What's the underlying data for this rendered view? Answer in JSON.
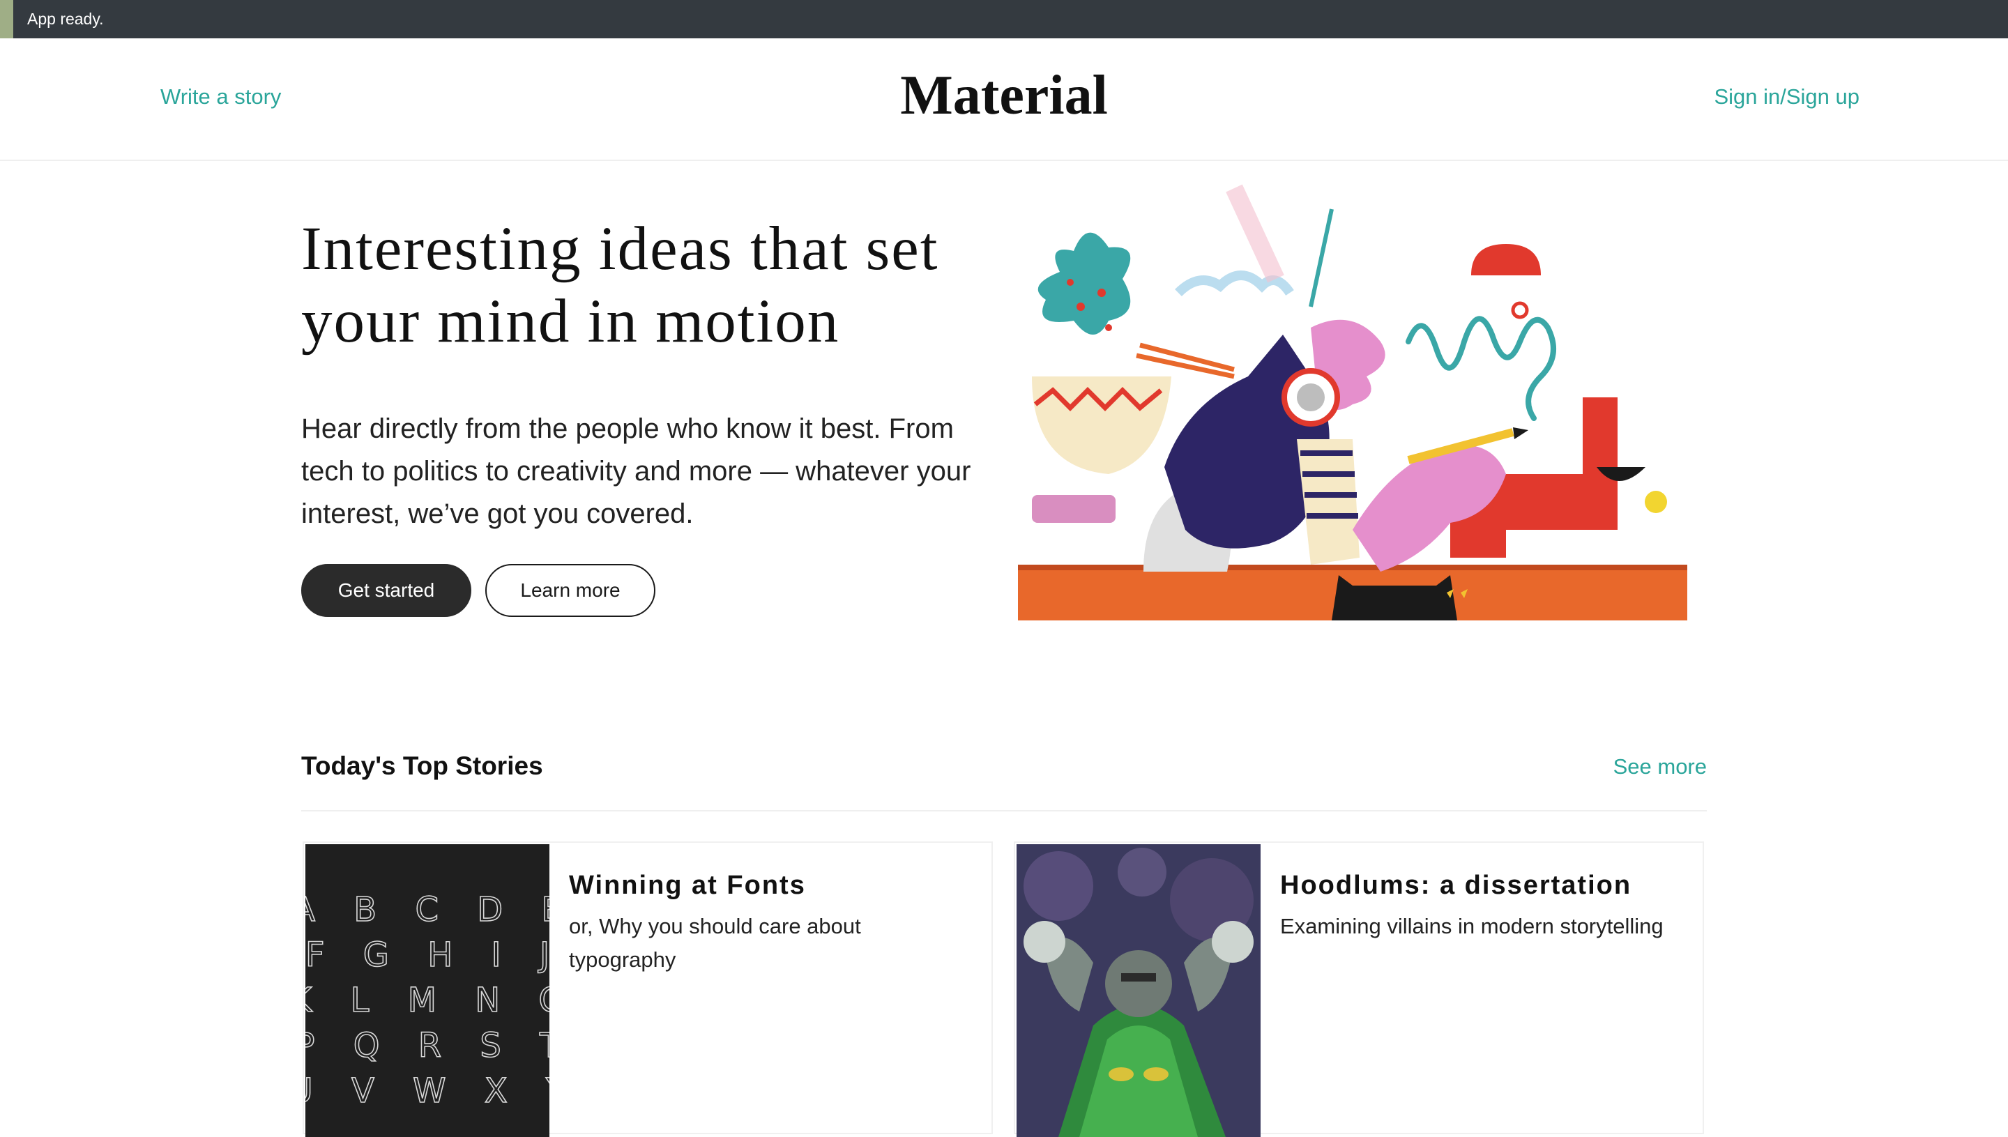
{
  "status": {
    "text": "App ready.",
    "bar_color": "#343a40",
    "accent_color": "#9fae86"
  },
  "header": {
    "write_link": "Write a story",
    "brand": "Material",
    "signin_link": "Sign in/Sign up",
    "link_color": "#2aa59a"
  },
  "hero": {
    "title": "Interesting ideas that set your mind in motion",
    "description": "Hear directly from the people who know it best. From tech to politics to creativity and more — whatever your interest, we’ve got you covered.",
    "primary_button": "Get started",
    "secondary_button": "Learn more",
    "illustration": "person-with-headphones-writing-illustration"
  },
  "top_stories": {
    "title": "Today's Top Stories",
    "see_more": "See more",
    "stories": [
      {
        "title": "Winning at Fonts",
        "subtitle": "or, Why you should care about typography",
        "thumbnail": "alphabet-typography-poster",
        "thumb_letters": [
          "A B C D E",
          "F G H I J",
          "K L M N O",
          "P Q R S T",
          "U V W X Y"
        ]
      },
      {
        "title": "Hoodlums: a dissertation",
        "subtitle": "Examining villains in modern storytelling",
        "thumbnail": "comic-villain-art"
      }
    ]
  }
}
